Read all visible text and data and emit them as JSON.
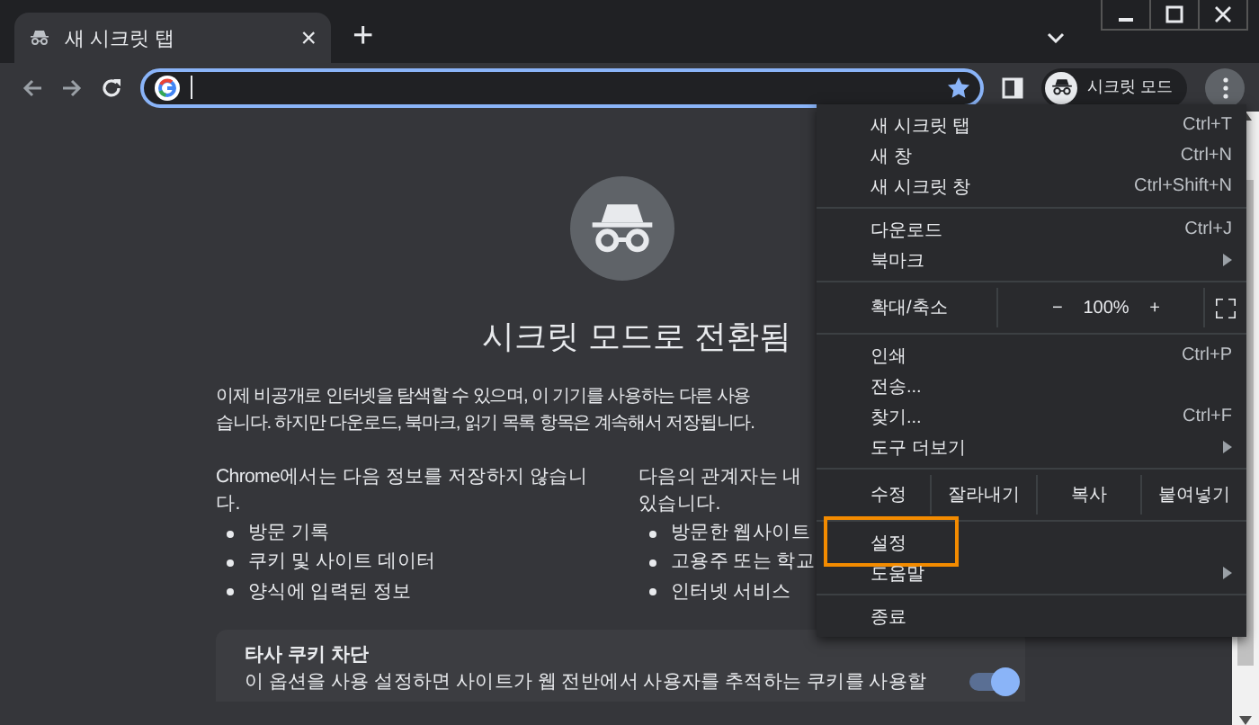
{
  "tab": {
    "title": "새 시크릿 탭",
    "close": "×"
  },
  "new_tab": "+",
  "toolbar": {
    "profile": "시크릿 모드",
    "bookmarked": true
  },
  "page": {
    "title": "시크릿 모드로 전환됨",
    "intro_lines": [
      "이제 비공개로 인터넷을 탐색할 수 있으며, 이 기기를 사용하는 다른 사용",
      "습니다. 하지만 다운로드, 북마크, 읽기 목록 항목은 계속해서 저장됩니다."
    ],
    "columns": [
      {
        "heading_lines": [
          "Chrome에서는 다음 정보를 저장하지 않습니",
          "다."
        ],
        "bullets": [
          "방문 기록",
          "쿠키 및 사이트 데이터",
          "양식에 입력된 정보"
        ]
      },
      {
        "heading_lines": [
          "다음의 관계자는 내",
          "있습니다."
        ],
        "bullets": [
          "방문한 웹사이트",
          "고용주 또는 학교",
          "인터넷 서비스"
        ]
      }
    ],
    "cookie_card": {
      "title": "타사 쿠키 차단",
      "text": "이 옵션을 사용 설정하면 사이트가 웹 전반에서 사용자를 추적하는 쿠키를 사용할",
      "on": true
    }
  },
  "menu": [
    {
      "kind": "item",
      "label": "새 시크릿 탭",
      "shortcut": "Ctrl+T"
    },
    {
      "kind": "item",
      "label": "새 창",
      "shortcut": "Ctrl+N"
    },
    {
      "kind": "item",
      "label": "새 시크릿 창",
      "shortcut": "Ctrl+Shift+N"
    },
    {
      "kind": "divider"
    },
    {
      "kind": "item",
      "label": "다운로드",
      "shortcut": "Ctrl+J"
    },
    {
      "kind": "item",
      "label": "북마크",
      "submenu": true
    },
    {
      "kind": "divider"
    },
    {
      "kind": "zoom",
      "label": "확대/축소",
      "minus": "−",
      "value": "100%",
      "plus": "+"
    },
    {
      "kind": "divider"
    },
    {
      "kind": "item",
      "label": "인쇄",
      "shortcut": "Ctrl+P"
    },
    {
      "kind": "item",
      "label": "전송..."
    },
    {
      "kind": "item",
      "label": "찾기...",
      "shortcut": "Ctrl+F"
    },
    {
      "kind": "item",
      "label": "도구 더보기",
      "submenu": true
    },
    {
      "kind": "divider"
    },
    {
      "kind": "edit",
      "label": "수정",
      "buttons": [
        "잘라내기",
        "복사",
        "붙여넣기"
      ]
    },
    {
      "kind": "divider"
    },
    {
      "kind": "item",
      "label": "설정",
      "outlined": true
    },
    {
      "kind": "item",
      "label": "도움말",
      "submenu": true
    },
    {
      "kind": "divider"
    },
    {
      "kind": "item",
      "label": "종료"
    }
  ]
}
